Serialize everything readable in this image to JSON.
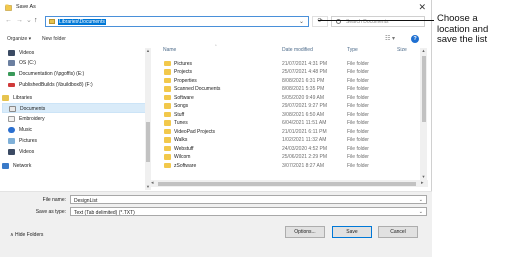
{
  "window": {
    "title": "Save As",
    "close_glyph": "✕"
  },
  "nav_buttons": {
    "back": "←",
    "forward": "→",
    "recent": "⌄",
    "up": "↑"
  },
  "address": {
    "path": "Libraries\\Documents",
    "dropdown_glyph": "⌄",
    "refresh_glyph": "⟳"
  },
  "search": {
    "placeholder": "Search Documents"
  },
  "toolbar": {
    "organize": "Organize ▾",
    "new_folder": "New folder",
    "view": "☷ ▾",
    "help": "?"
  },
  "nav_pane": {
    "items": [
      {
        "label": "Videos",
        "icon": "videos-icon"
      },
      {
        "label": "OS (C:)",
        "icon": "drive-icon"
      },
      {
        "label": "Documentation (\\\\pgoffis) (E:)",
        "icon": "network-drive-icon"
      },
      {
        "label": "PublishedBuilds (\\\\buildbox8) (F:)",
        "icon": "network-drive-icon"
      },
      {
        "label": "Libraries",
        "icon": "libraries-icon"
      },
      {
        "label": "Documents",
        "icon": "documents-icon",
        "selected": true
      },
      {
        "label": "Embroidery",
        "icon": "embroidery-icon"
      },
      {
        "label": "Music",
        "icon": "music-icon"
      },
      {
        "label": "Pictures",
        "icon": "pictures-icon"
      },
      {
        "label": "Videos",
        "icon": "videos-icon"
      },
      {
        "label": "Network",
        "icon": "network-icon"
      }
    ]
  },
  "columns": {
    "name": "Name",
    "date": "Date modified",
    "type": "Type",
    "size": "Size"
  },
  "files": [
    {
      "name": "Pictures",
      "date": "21/07/2021 4:31 PM",
      "type": "File folder"
    },
    {
      "name": "Projects",
      "date": "25/07/2021 4:48 PM",
      "type": "File folder"
    },
    {
      "name": "Properties",
      "date": "8/08/2021 6:31 PM",
      "type": "File folder"
    },
    {
      "name": "Scanned Documents",
      "date": "8/08/2021 5:35 PM",
      "type": "File folder"
    },
    {
      "name": "Software",
      "date": "5/05/2020 9:49 AM",
      "type": "File folder"
    },
    {
      "name": "Songs",
      "date": "29/07/2021 9:27 PM",
      "type": "File folder"
    },
    {
      "name": "Stuff",
      "date": "3/08/2021 6:50 AM",
      "type": "File folder"
    },
    {
      "name": "Tunes",
      "date": "6/04/2021 11:51 AM",
      "type": "File folder"
    },
    {
      "name": "VideoPad Projects",
      "date": "21/01/2021 6:11 PM",
      "type": "File folder"
    },
    {
      "name": "Walks",
      "date": "1/02/2021 11:32 AM",
      "type": "File folder"
    },
    {
      "name": "Webstuff",
      "date": "24/03/2020 4:52 PM",
      "type": "File folder"
    },
    {
      "name": "Wilcom",
      "date": "25/06/2021 2:29 PM",
      "type": "File folder"
    },
    {
      "name": "zSoftware",
      "date": "3/07/2021 8:27 AM",
      "type": "File folder"
    }
  ],
  "form": {
    "filename_label": "File name:",
    "filename_value": "DesignList",
    "savetype_label": "Save as type:",
    "savetype_value": "Text (Tab delimited) (*.TXT)"
  },
  "footer": {
    "hide_folders": "∧  Hide Folders",
    "options": "Options...",
    "save": "Save",
    "cancel": "Cancel"
  },
  "callout": {
    "text": "Choose a location and save the list"
  },
  "colors": {
    "accent": "#0078d7",
    "folder": "#f2c84b",
    "selection": "#d9ebf9"
  }
}
